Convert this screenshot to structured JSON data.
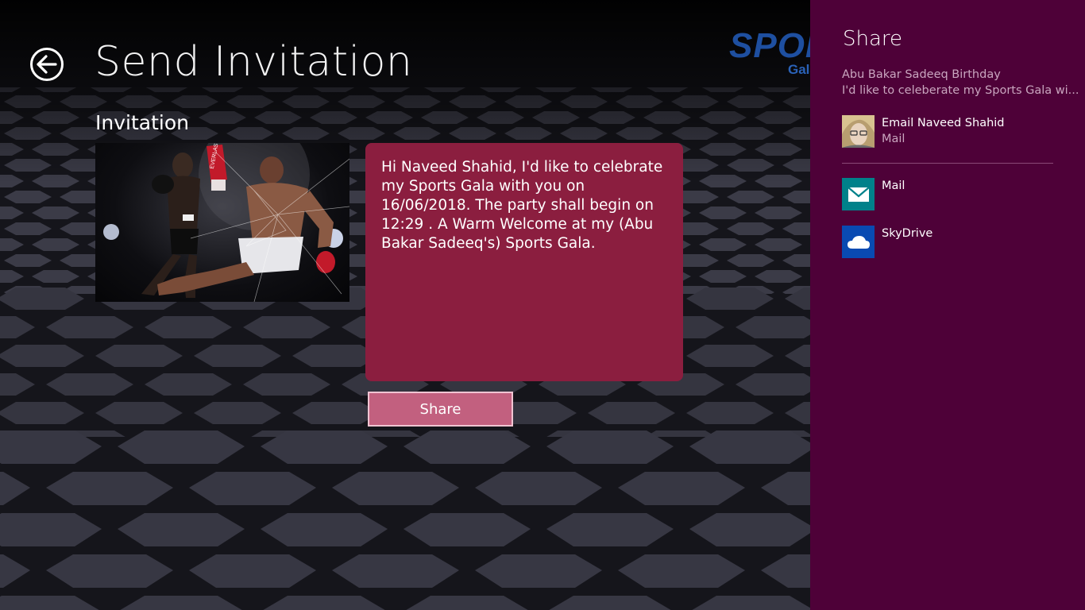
{
  "page": {
    "title": "Send Invitation",
    "section_title": "Invitation",
    "brand_text": "SPOR",
    "brand_sub": "Gala"
  },
  "invitation": {
    "message": "Hi Naveed Shahid, I'd like to celebrate my Sports Gala with you on 16/06/2018. The party shall begin on 12:29 . A Warm Welcome at my (Abu Bakar Sadeeq's) Sports Gala.",
    "share_label": "Share",
    "photo_icon": "boxing-photo"
  },
  "colors": {
    "message_bg": "#8b1e3f",
    "share_button_bg": "#c2607f",
    "charm_bg": "#4e0138",
    "mail_tile": "#00818a",
    "skydrive_tile": "#094ab2"
  },
  "charm": {
    "title": "Share",
    "subtitle": "Abu Bakar Sadeeq Birthday",
    "description": "I'd like to celeberate my Sports Gala wi...",
    "frequent": {
      "name": "Email Naveed Shahid",
      "app": "Mail",
      "icon": "avatar"
    },
    "apps": [
      {
        "label": "Mail",
        "icon": "mail-icon"
      },
      {
        "label": "SkyDrive",
        "icon": "cloud-icon"
      }
    ]
  }
}
